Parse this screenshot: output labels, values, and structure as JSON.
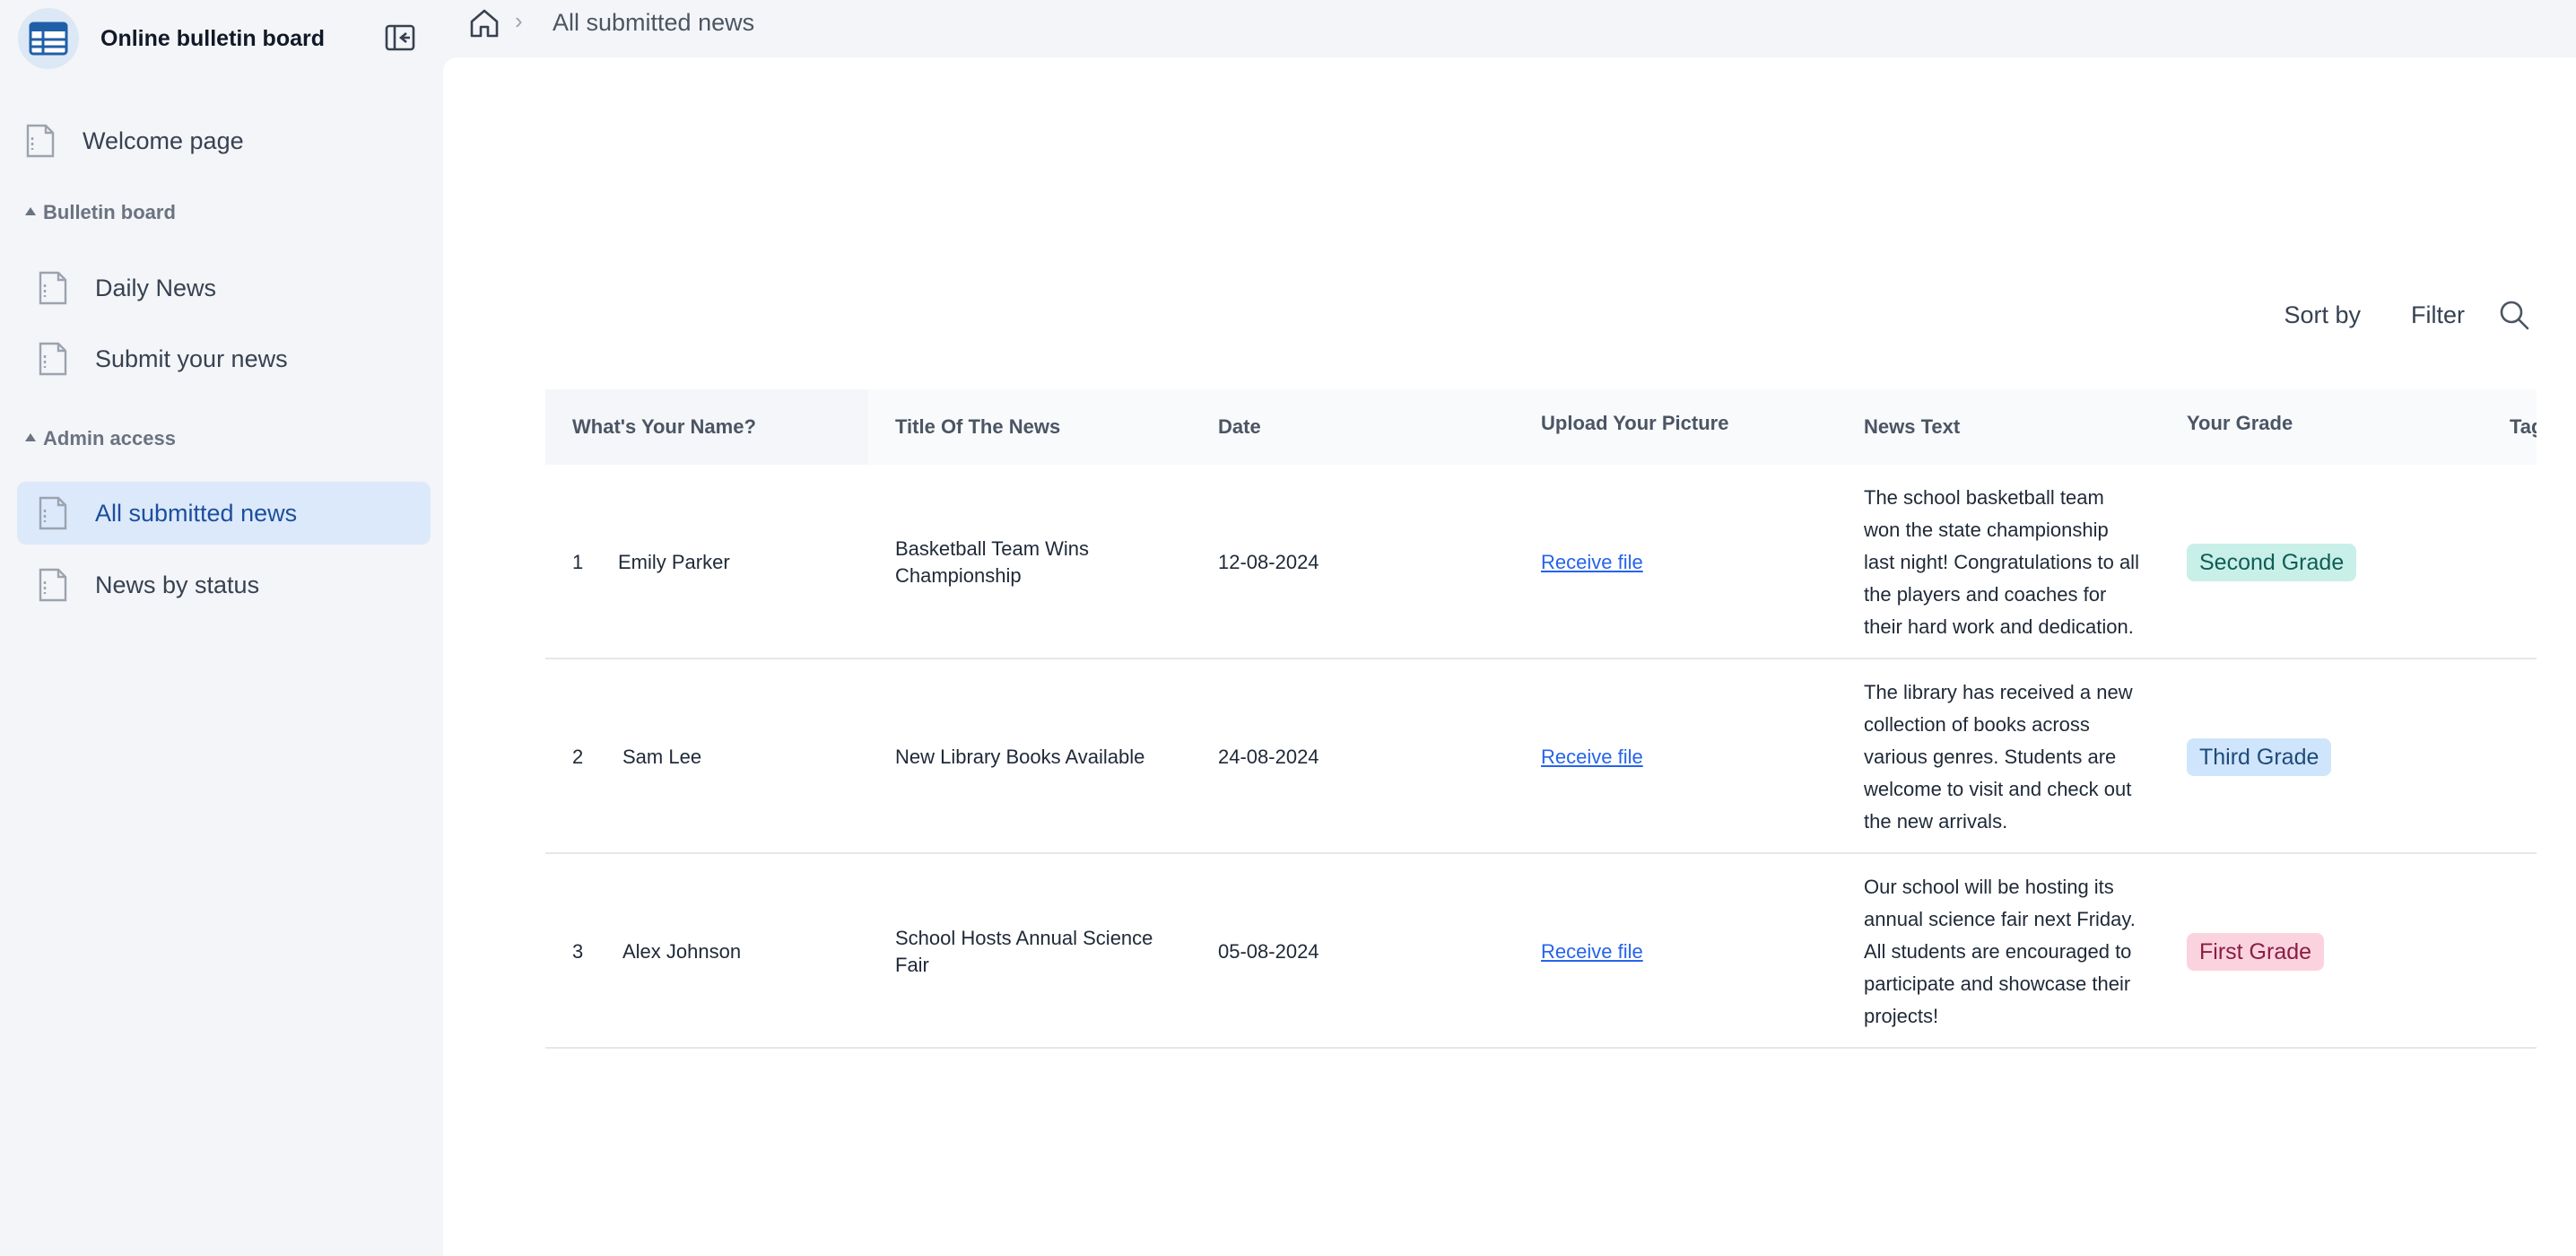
{
  "app": {
    "title": "Online bulletin board"
  },
  "sidebar": {
    "welcome": "Welcome page",
    "sections": [
      {
        "label": "Bulletin board",
        "items": [
          {
            "label": "Daily News"
          },
          {
            "label": "Submit your news"
          }
        ]
      },
      {
        "label": "Admin access",
        "items": [
          {
            "label": "All submitted news",
            "active": true
          },
          {
            "label": "News by status"
          }
        ]
      }
    ]
  },
  "breadcrumb": {
    "separator": "›",
    "current": "All submitted news"
  },
  "toolbar": {
    "sort_label": "Sort by",
    "filter_label": "Filter"
  },
  "table": {
    "columns": [
      "What's Your Name?",
      "Title Of The News",
      "Date",
      "Upload Your Picture",
      "News Text",
      "Your Grade",
      "Tag"
    ],
    "rows": [
      {
        "num": "1",
        "name": "Emily Parker",
        "title": "Basketball Team Wins Championship",
        "date": "12-08-2024",
        "file": "Receive file",
        "text": "The school basketball team won the state championship last night! Congratulations to all the players and coaches for their hard work and dedication.",
        "grade": "Second Grade",
        "grade_bg": "#c9efe9",
        "grade_fg": "#0f5e55"
      },
      {
        "num": "2",
        "name": "Sam Lee",
        "title": "New Library Books Available",
        "date": "24-08-2024",
        "file": "Receive file",
        "text": "The library has received a new collection of books across various genres. Students are welcome to visit and check out the new arrivals.",
        "grade": "Third Grade",
        "grade_bg": "#cfe5fb",
        "grade_fg": "#1e4a7a"
      },
      {
        "num": "3",
        "name": "Alex Johnson",
        "title": "School Hosts Annual Science Fair",
        "date": "05-08-2024",
        "file": "Receive file",
        "text": "Our school will be hosting its annual science fair next Friday. All students are encouraged to participate and showcase their projects!",
        "grade": "First Grade",
        "grade_bg": "#fbd3df",
        "grade_fg": "#8a1d44"
      }
    ]
  },
  "colors": {
    "accent": "#1d4e9c",
    "active_bg": "#dbe9fb",
    "link": "#2563eb"
  },
  "icons": {
    "logo": "calendar-table-icon",
    "collapse": "sidebar-collapse-icon",
    "home": "home-icon",
    "page": "page-icon",
    "search": "search-icon"
  }
}
